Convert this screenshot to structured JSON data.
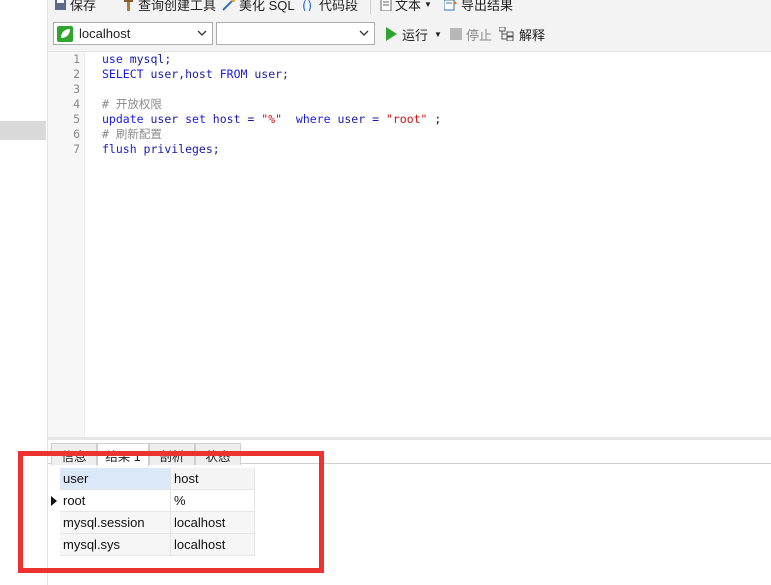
{
  "toolbar": {
    "save_label": "保存",
    "query_builder_label": "查询创建工具",
    "beautify_label": "美化 SQL",
    "snippet_label": "代码段",
    "text_label": "文本",
    "export_label": "导出结果"
  },
  "connection": {
    "host_value": "localhost",
    "database_value": "",
    "run_label": "运行",
    "stop_label": "停止",
    "explain_label": "解释"
  },
  "editor": {
    "line_numbers": [
      "1",
      "2",
      "3",
      "4",
      "5",
      "6",
      "7"
    ],
    "l1": {
      "kw": "use",
      "rest": " mysql;"
    },
    "l2": {
      "kw1": "SELECT",
      "cols": " user,host ",
      "kw2": "FROM",
      "rest": " user;"
    },
    "l4": "# 开放权限",
    "l5": {
      "kw1": "update",
      "p1": " user ",
      "kw2": "set",
      "p2": " host = ",
      "s1": "\"%\"",
      "p3": "  ",
      "kw3": "where",
      "p4": " user = ",
      "s2": "\"root\"",
      "p5": " ;"
    },
    "l6": "# 刷新配置",
    "l7": {
      "kw": "flush",
      "rest": " privileges;"
    }
  },
  "result_tabs": [
    "信息",
    "结果 1",
    "剖析",
    "状态"
  ],
  "result_table": {
    "columns": [
      "user",
      "host"
    ],
    "rows": [
      [
        "root",
        "%"
      ],
      [
        "mysql.session",
        "localhost"
      ],
      [
        "mysql.sys",
        "localhost"
      ]
    ]
  },
  "colors": {
    "highlight_border": "#ee3232",
    "run_green": "#2fa52f",
    "keyword_blue": "#1a1ae6",
    "string_red": "#d01010"
  }
}
